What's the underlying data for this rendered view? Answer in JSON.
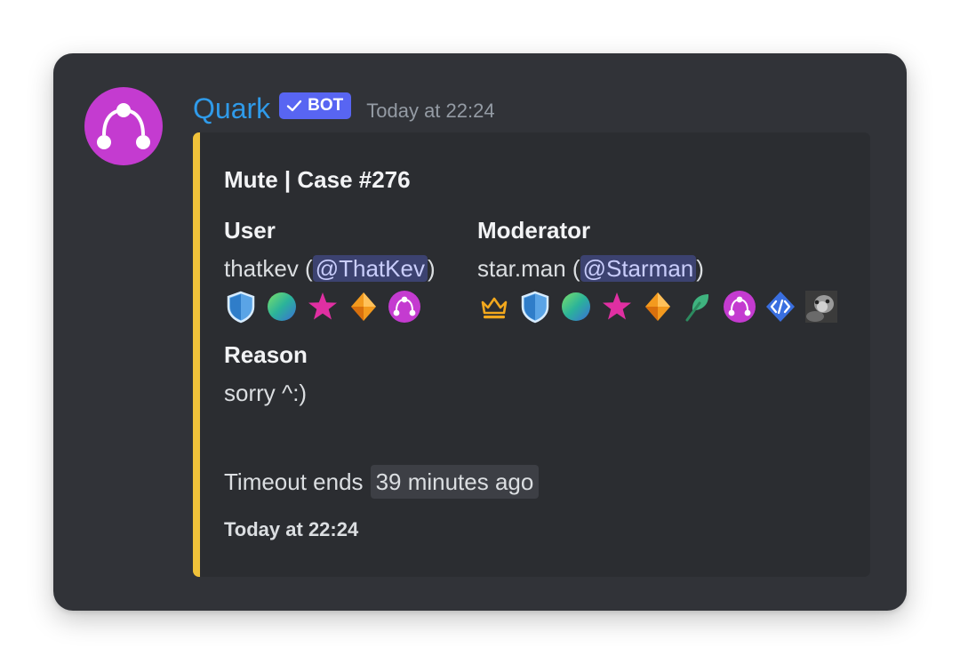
{
  "message": {
    "author": {
      "name": "Quark",
      "tag": "BOT",
      "avatar": "quark-logo-icon",
      "name_color": "#2f9bea",
      "avatar_color": "#c43bd0"
    },
    "timestamp": "Today at 22:24",
    "embed": {
      "accent_color": "#f0c23a",
      "title": "Mute | Case #276",
      "fields": [
        {
          "name": "User",
          "prefix": "thatkev (",
          "mention": "@ThatKev",
          "suffix": ")",
          "badges": [
            "shield-icon",
            "globe-icon",
            "star-icon",
            "diamond-icon",
            "quark-logo-icon"
          ]
        },
        {
          "name": "Moderator",
          "prefix": "star.man (",
          "mention": "@Starman",
          "suffix": ")",
          "badges": [
            "crown-icon",
            "shield-icon",
            "globe-icon",
            "star-icon",
            "diamond-icon",
            "leaf-icon",
            "quark-logo-icon",
            "code-icon",
            "photo-icon"
          ]
        },
        {
          "name": "Reason",
          "value": "sorry ^:)"
        }
      ],
      "timeout_label": "Timeout ends",
      "timeout_value": "39 minutes ago",
      "footer_time": "Today at 22:24"
    }
  }
}
